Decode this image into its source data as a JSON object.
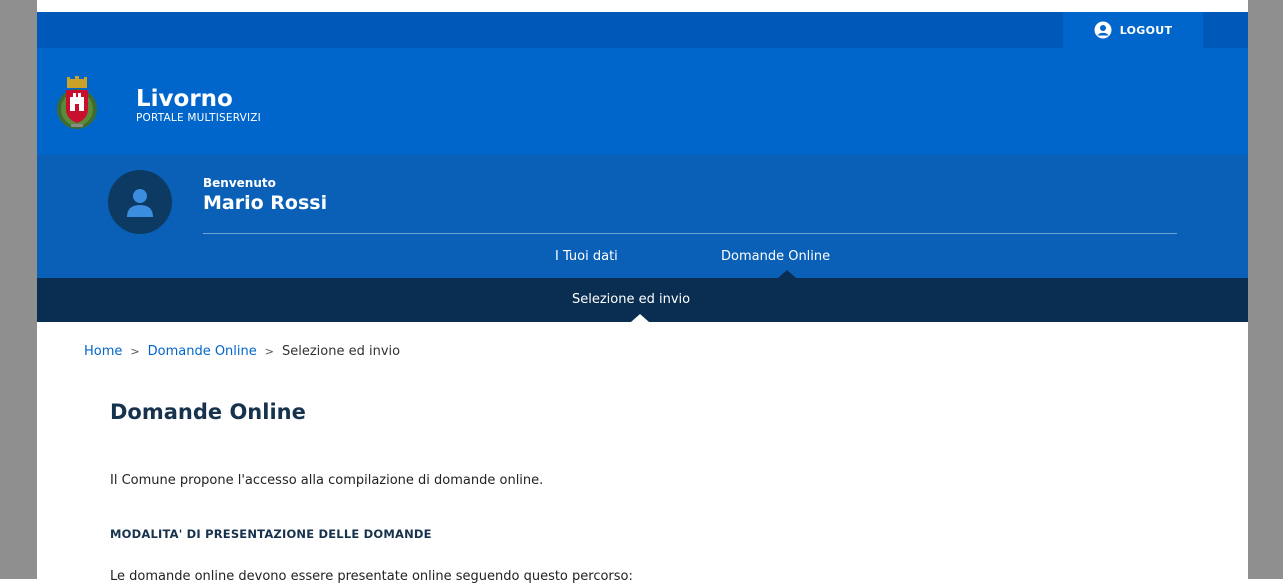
{
  "topbar": {
    "logout_label": "LOGOUT"
  },
  "brand": {
    "title": "Livorno",
    "subtitle": "PORTALE MULTISERVIZI"
  },
  "user": {
    "welcome": "Benvenuto",
    "name": "Mario Rossi"
  },
  "tabs": [
    {
      "label": "I Tuoi dati"
    },
    {
      "label": "Domande Online",
      "active": true
    }
  ],
  "subnav": {
    "label": "Selezione ed invio"
  },
  "breadcrumb": {
    "home": "Home",
    "parent": "Domande Online",
    "current": "Selezione ed invio",
    "separator": ">"
  },
  "content": {
    "title": "Domande Online",
    "intro": "Il Comune propone l'accesso alla compilazione di domande online.",
    "section_heading": "MODALITA' DI PRESENTAZIONE DELLE DOMANDE",
    "section_text": "Le domande online devono essere presentate online seguendo questo percorso:"
  },
  "colors": {
    "topbar": "#0058b8",
    "brand": "#0066cc",
    "user_section": "#0a60b6",
    "subnav": "#0a2e52",
    "link": "#0066cc",
    "title": "#17324d"
  },
  "icons": {
    "logout": "user-circle-icon",
    "avatar": "user-icon",
    "crest": "coat-of-arms-logo"
  }
}
